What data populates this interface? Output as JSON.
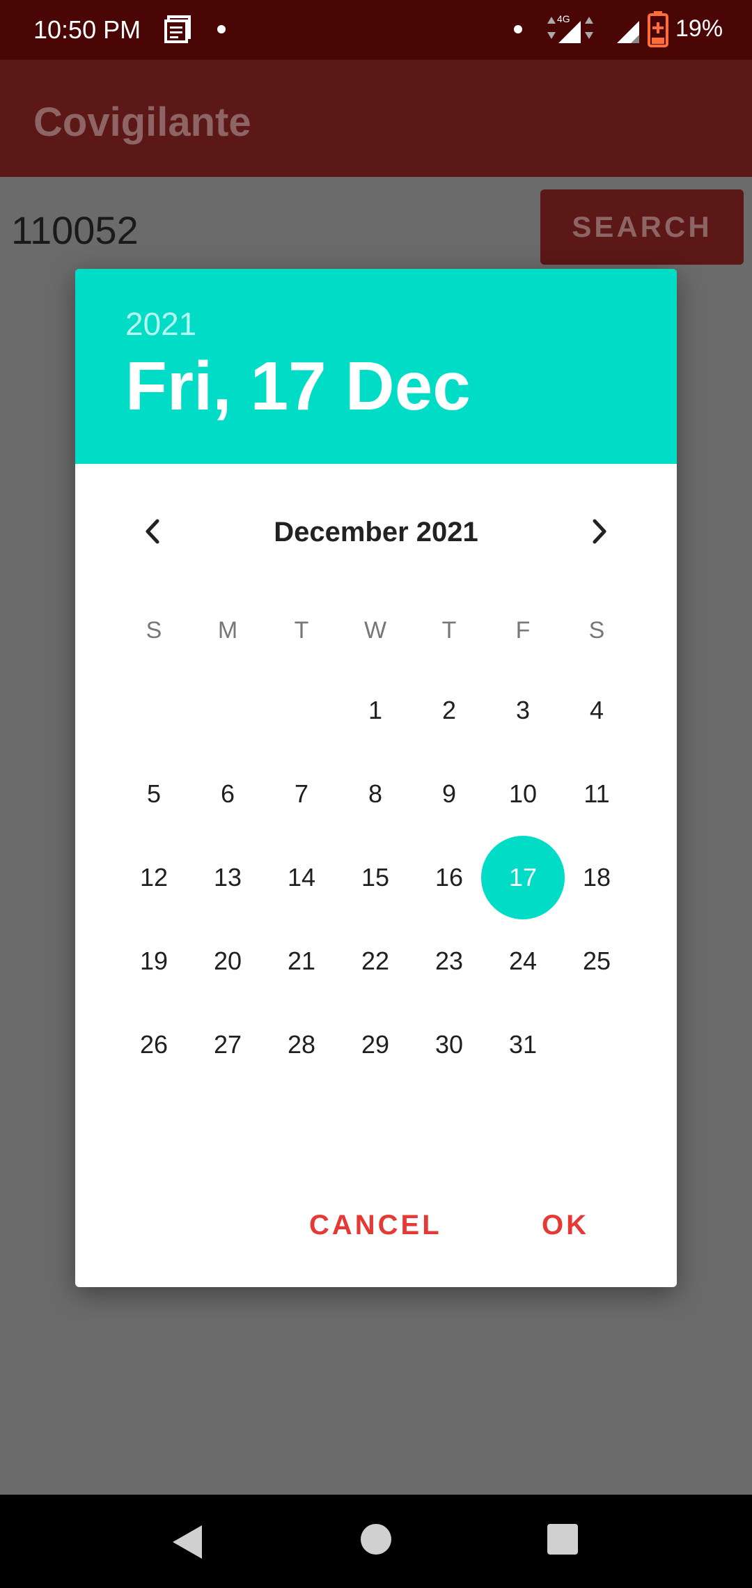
{
  "status_bar": {
    "time": "10:50 PM",
    "network": "4G",
    "battery": "19%",
    "icons": [
      "news-icon",
      "dot-icon",
      "signal-icon",
      "battery-icon"
    ]
  },
  "app_bar": {
    "title": "Covigilante"
  },
  "main": {
    "pin_value": "110052",
    "search_label": "SEARCH"
  },
  "date_picker": {
    "header_year": "2021",
    "header_date": "Fri, 17 Dec",
    "month_label": "December 2021",
    "weekdays": [
      "S",
      "M",
      "T",
      "W",
      "T",
      "F",
      "S"
    ],
    "selected_day": "17",
    "days": [
      "1",
      "2",
      "3",
      "4",
      "5",
      "6",
      "7",
      "8",
      "9",
      "10",
      "11",
      "12",
      "13",
      "14",
      "15",
      "16",
      "17",
      "18",
      "19",
      "20",
      "21",
      "22",
      "23",
      "24",
      "25",
      "26",
      "27",
      "28",
      "29",
      "30",
      "31"
    ],
    "cancel_label": "CANCEL",
    "ok_label": "OK"
  },
  "colors": {
    "status_bar": "#4a0505",
    "app_bar": "#5c1717",
    "accent": "#00dcc6",
    "action_text": "#e53935"
  }
}
